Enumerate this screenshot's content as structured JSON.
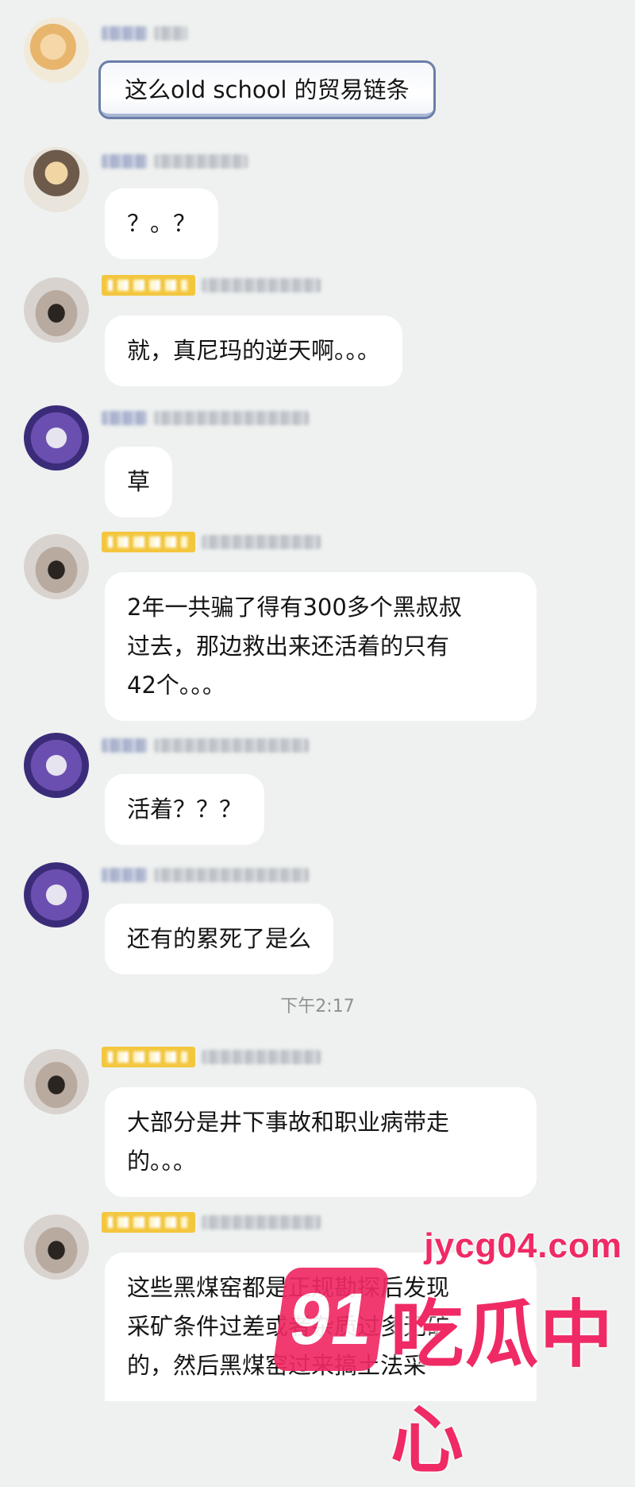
{
  "messages": [
    {
      "text": "这么old school 的贸易链条"
    },
    {
      "text": "？。？"
    },
    {
      "text": "就，真尼玛的逆天啊。。。"
    },
    {
      "text": "草"
    },
    {
      "text": "2年一共骗了得有300多个黑叔叔\n过去，那边救出来还活着的只有\n42个。。。"
    },
    {
      "text": "活着？？？"
    },
    {
      "text": "还有的累死了是么"
    },
    {
      "text": "大部分是井下事故和职业病带走\n的。。。"
    },
    {
      "text": "这些黑煤窑都是正规勘探后发现\n采矿条件过差或者杂质过多无矿\n的，然后黑煤窑过来搞土法采"
    }
  ],
  "timestamp": "下午2:17",
  "watermark": {
    "url": "jycg04.com",
    "logo": "91",
    "brand": "吃瓜中心"
  },
  "colors": {
    "background": "#eef1ef",
    "bubble": "#ffffff",
    "badge": "#f3c63d",
    "watermark": "#ef2a64"
  }
}
